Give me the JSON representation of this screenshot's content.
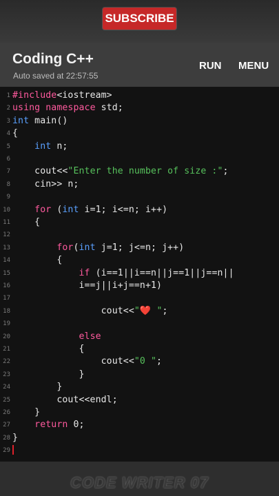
{
  "promo": {
    "subscribe_label": "SUBSCRIBE"
  },
  "app": {
    "title": "Coding C++",
    "autosave": "Auto saved at 22:57:55",
    "run_label": "RUN",
    "menu_label": "MENU"
  },
  "editor": {
    "lines": [
      {
        "n": "1",
        "t": "#include<iostream>"
      },
      {
        "n": "2",
        "t": "using namespace std;"
      },
      {
        "n": "3",
        "t": "int main()"
      },
      {
        "n": "4",
        "t": "{"
      },
      {
        "n": "5",
        "t": "    int n;"
      },
      {
        "n": "6",
        "t": ""
      },
      {
        "n": "7",
        "t": "    cout<<\"Enter the number of size :\";"
      },
      {
        "n": "8",
        "t": "    cin>> n;"
      },
      {
        "n": "9",
        "t": ""
      },
      {
        "n": "10",
        "t": "    for (int i=1; i<=n; i++)"
      },
      {
        "n": "11",
        "t": "    {"
      },
      {
        "n": "12",
        "t": ""
      },
      {
        "n": "13",
        "t": "        for(int j=1; j<=n; j++)"
      },
      {
        "n": "14",
        "t": "        {"
      },
      {
        "n": "15",
        "t": "            if (i==1||i==n||j==1||j==n||"
      },
      {
        "n": "16",
        "t": "            i==j||i+j==n+1)"
      },
      {
        "n": "17",
        "t": ""
      },
      {
        "n": "18",
        "t": "                cout<<\"❤️ \";"
      },
      {
        "n": "19",
        "t": ""
      },
      {
        "n": "20",
        "t": "            else"
      },
      {
        "n": "21",
        "t": "            {"
      },
      {
        "n": "22",
        "t": "                cout<<\"0 \";"
      },
      {
        "n": "23",
        "t": "            }"
      },
      {
        "n": "24",
        "t": "        }"
      },
      {
        "n": "25",
        "t": "        cout<<endl;"
      },
      {
        "n": "26",
        "t": "    }"
      },
      {
        "n": "27",
        "t": "    return 0;"
      },
      {
        "n": "28",
        "t": "}"
      },
      {
        "n": "29",
        "t": ""
      }
    ]
  },
  "watermark": "CODE WRITER 07",
  "colors": {
    "keyword": "#ff5a9e",
    "type": "#5aa0ff",
    "string": "#57c15c",
    "subscribe_bg": "#c62828"
  }
}
